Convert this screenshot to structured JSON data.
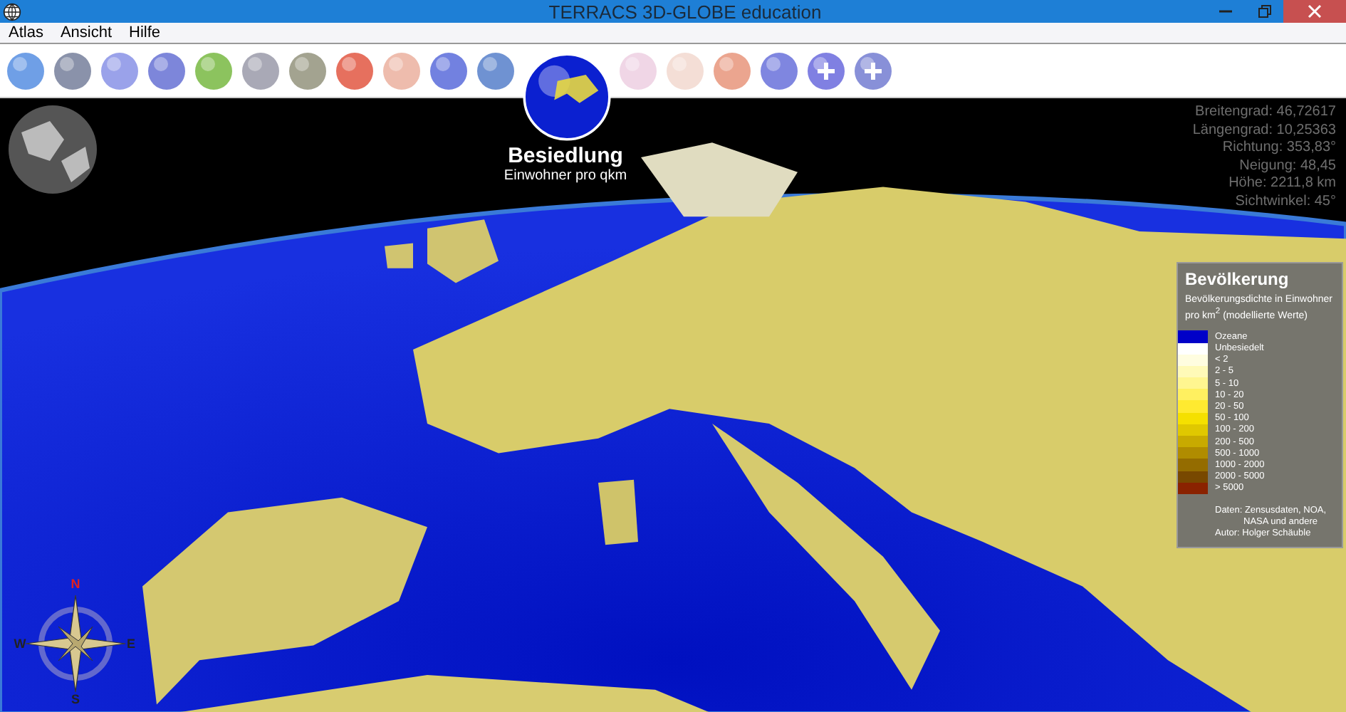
{
  "window": {
    "title": "TERRACS 3D-GLOBE education"
  },
  "menu": [
    {
      "label": "Atlas"
    },
    {
      "label": "Ansicht"
    },
    {
      "label": "Hilfe"
    }
  ],
  "toolbar": {
    "globes": [
      {
        "kind": "plain",
        "color": "#6f9fe6",
        "selected": false
      },
      {
        "kind": "plain",
        "color": "#8a92aa",
        "selected": false
      },
      {
        "kind": "plain",
        "color": "#9aa2ea",
        "selected": false
      },
      {
        "kind": "plain",
        "color": "#7d86da",
        "selected": false
      },
      {
        "kind": "plain",
        "color": "#8cc35e",
        "selected": false
      },
      {
        "kind": "plain",
        "color": "#a9a9b6",
        "selected": false
      },
      {
        "kind": "plain",
        "color": "#a3a390",
        "selected": false
      },
      {
        "kind": "plain",
        "color": "#e6705e",
        "selected": false
      },
      {
        "kind": "plain",
        "color": "#eebcad",
        "selected": false
      },
      {
        "kind": "plain",
        "color": "#7281e0",
        "selected": false
      },
      {
        "kind": "plain",
        "color": "#6f92d2",
        "selected": false
      },
      {
        "kind": "plain",
        "color": "#0b20d0",
        "selected": true
      },
      {
        "kind": "plain",
        "color": "#f0d6e6",
        "selected": false
      },
      {
        "kind": "plain",
        "color": "#f4ded6",
        "selected": false
      },
      {
        "kind": "plain",
        "color": "#eba58f",
        "selected": false
      },
      {
        "kind": "plain",
        "color": "#7f86e0",
        "selected": false
      },
      {
        "kind": "plus",
        "color": "#8080e2",
        "selected": false
      },
      {
        "kind": "plus",
        "color": "#8890d8",
        "selected": false
      }
    ]
  },
  "active_layer": {
    "title": "Besiedlung",
    "subtitle": "Einwohner pro qkm"
  },
  "position_info": [
    "Breitengrad: 46,72617",
    "Längengrad: 10,25363",
    "Richtung: 353,83°",
    "Neigung: 48,45",
    "Höhe: 2211,8 km",
    "Sichtwinkel: 45°"
  ],
  "legend": {
    "title": "Bevölkerung",
    "description": "Bevölkerungsdichte in Einwohner pro km$^{2}$ (modellierte Werte)",
    "entries": [
      {
        "label": "Ozeane",
        "color": "#0000c8"
      },
      {
        "label": "Unbesiedelt",
        "color": "#ffffff"
      },
      {
        "label": "< 2",
        "color": "#fffde0"
      },
      {
        "label": "2 - 5",
        "color": "#fffab8"
      },
      {
        "label": "5 - 10",
        "color": "#fff690"
      },
      {
        "label": "10 - 20",
        "color": "#fff060"
      },
      {
        "label": "20 - 50",
        "color": "#ffea30"
      },
      {
        "label": "50 - 100",
        "color": "#f5e000"
      },
      {
        "label": "100 - 200",
        "color": "#e0c800"
      },
      {
        "label": "200 - 500",
        "color": "#c8aa00"
      },
      {
        "label": "500 - 1000",
        "color": "#b08c00"
      },
      {
        "label": "1000 - 2000",
        "color": "#946c00"
      },
      {
        "label": "2000 - 5000",
        "color": "#784800"
      },
      {
        "label": "> 5000",
        "color": "#8a2200"
      }
    ],
    "credits": [
      "Daten: Zensusdaten, NOA,",
      "NASA und andere",
      "Autor: Holger Schäuble"
    ]
  },
  "compass": {
    "labels": [
      "N",
      "E",
      "S",
      "W"
    ]
  }
}
